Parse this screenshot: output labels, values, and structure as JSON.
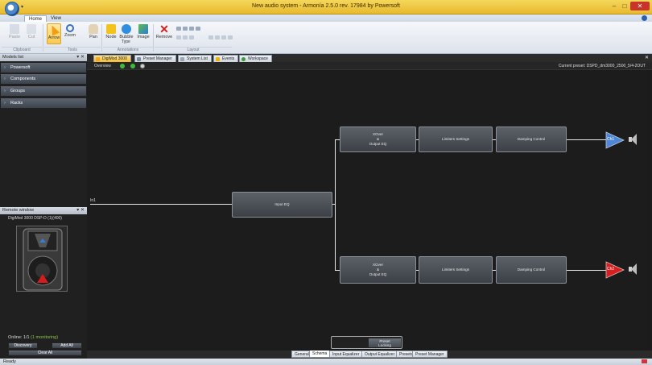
{
  "window": {
    "title": "New audio system - Armonía 2.5.0   rev. 17984 by Powersoft",
    "controls": [
      "–",
      "□",
      "✕"
    ]
  },
  "ribbon": {
    "tabs": [
      "Home",
      "View"
    ],
    "buttons": {
      "paste": "Paste",
      "cut": "Cut",
      "arrow": "Arrow",
      "zoom": "Zoom",
      "pan": "Pan",
      "node": "Node",
      "bubble": "Bubble",
      "image": "Image",
      "remove": "Remove"
    },
    "bubble_sub": "Type",
    "groups": {
      "clipboard": "Clipboard",
      "tools": "Tools",
      "annotations": "Annotations",
      "layout": "Layout"
    }
  },
  "left_panel": {
    "models": {
      "title": "Models list",
      "items": [
        "Powersoft",
        "Components",
        "Groups",
        "Racks"
      ]
    },
    "remote": {
      "title": "Remote window",
      "device": "DigiMod 3000 DSP-D (1)(400)",
      "status": "Online: 1/1",
      "status_detail": "(1 monitoring)",
      "buttons": {
        "discovery": "Discovery",
        "add_all": "Add All",
        "clear_all": "Clear All"
      }
    }
  },
  "doc_tabs": [
    "DigiMod 3000",
    "Preset Manager",
    "System List",
    "Events",
    "Workspace"
  ],
  "workspace": {
    "overview": "Overview",
    "current_preset": "Current preset: DSPD_dm3000_2500_5/4-2OUT",
    "blocks": {
      "input": "Input EQ",
      "xover_a": "XOver\n&\nOutput EQ",
      "xover_b": "XOver\n&\nOutput EQ",
      "limiter_a": "Limiters Settings",
      "limiter_b": "Limiters Settings",
      "damp_a": "Damping Control",
      "damp_b": "Damping Control",
      "ch1": "Ch1",
      "ch2": "Ch2"
    },
    "input_label": "In1",
    "lock": "Preset\nLocking"
  },
  "bottom_tabs": [
    "General",
    "Schema",
    "Input Equalizer",
    "Output Equalizer",
    "Presets",
    "Preset Manager"
  ],
  "status": "Ready",
  "colors": {
    "ch1": "#4f86d6",
    "ch2": "#d81f1f",
    "active_tab": "#f0bd36"
  }
}
